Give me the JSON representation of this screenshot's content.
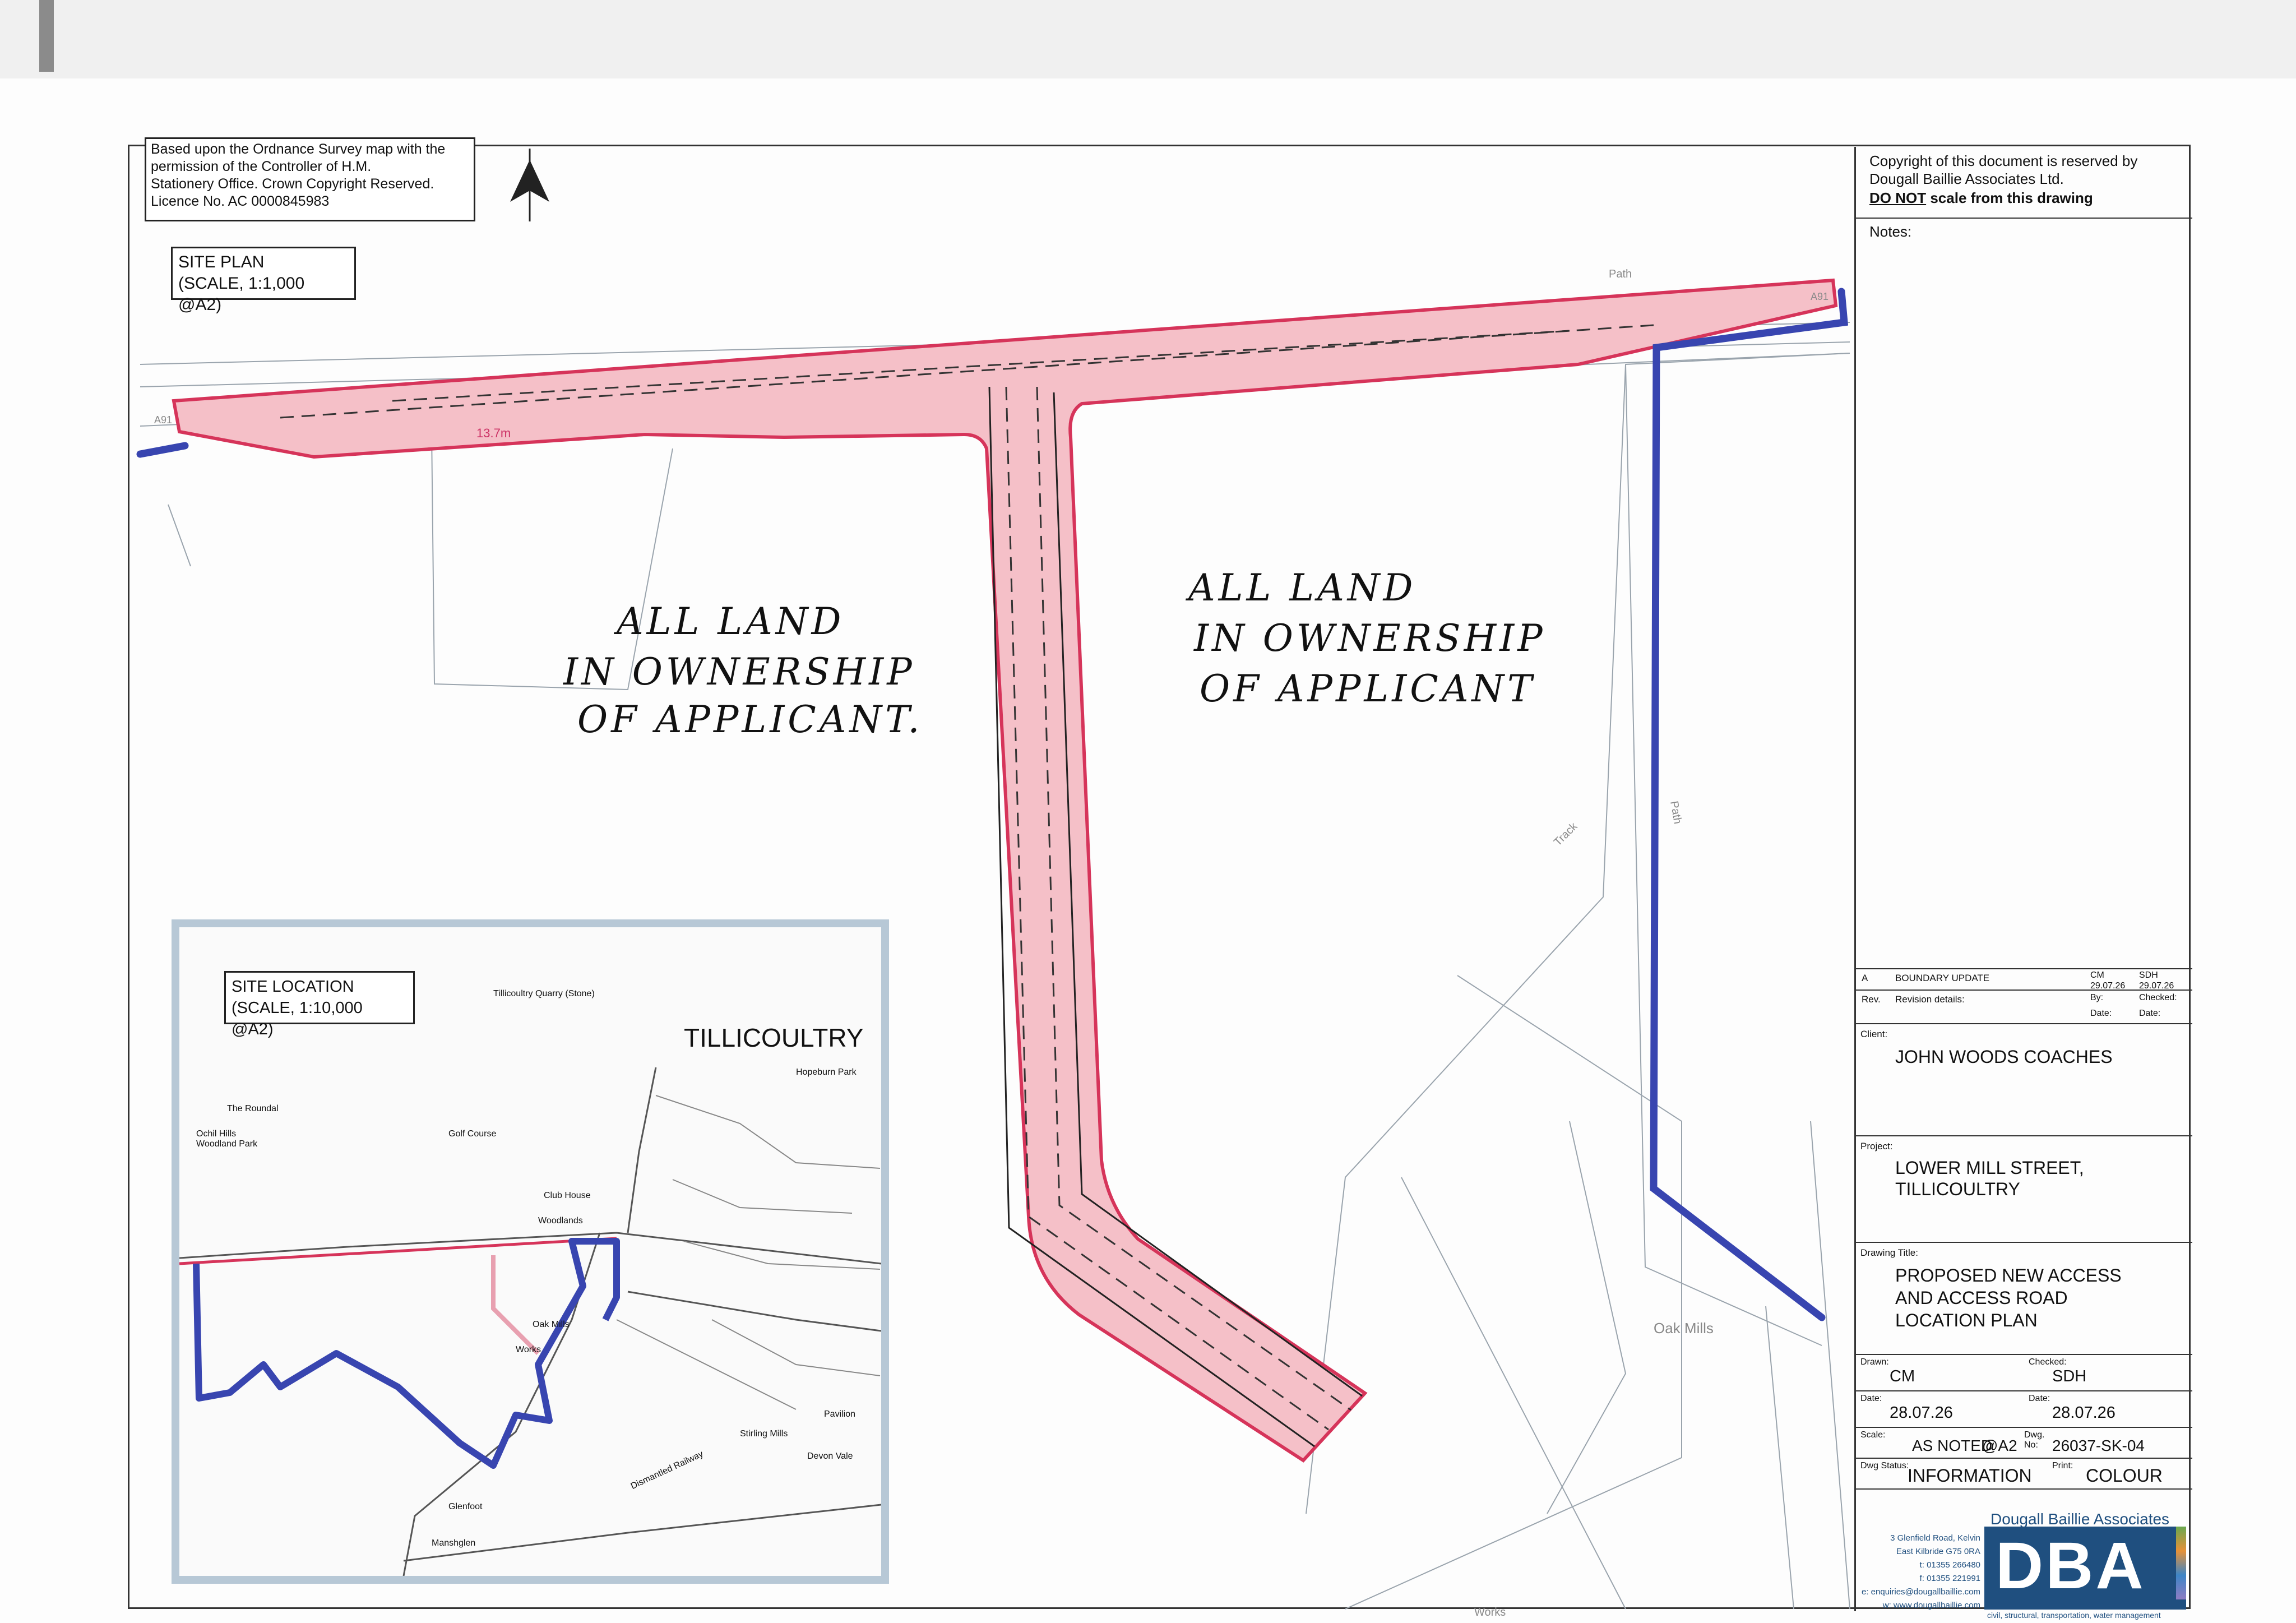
{
  "copyright_box": {
    "line1": "Based upon the Ordnance Survey map with the",
    "line2": "permission of the Controller of H.M.",
    "line3": "Stationery  Office. Crown Copyright Reserved.",
    "line4": "Licence No.  AC 0000845983"
  },
  "site_plan": {
    "title": "SITE PLAN",
    "scale": "(SCALE, 1:1,000 @A2)"
  },
  "map_labels": {
    "path_top": "Path",
    "path_right": "Path",
    "track": "Track",
    "height": "13.7m",
    "road_left": "A91",
    "road_right": "A91",
    "oak_mills": "Oak Mills",
    "works": "Works"
  },
  "handwritten": {
    "left": [
      "ALL LAND",
      "IN OWNERSHIP",
      "OF APPLICANT."
    ],
    "right": [
      "ALL LAND",
      "IN OWNERSHIP",
      "OF APPLICANT"
    ]
  },
  "inset": {
    "title": "SITE LOCATION",
    "scale": "(SCALE, 1:10,000 @A2)",
    "town": "TILLICOULTRY",
    "places": [
      "Tillicoultry Quarry (Stone)",
      "The Roundal",
      "Golf Course",
      "Ochil Hills Woodland Park",
      "Club House",
      "Woodlands",
      "Oak Mills",
      "Works",
      "Glenfoot",
      "Manshglen",
      "Stirling Mills",
      "Devon Vale",
      "Pavilion",
      "Hopeburn Park",
      "Dismantled Railway"
    ]
  },
  "title_block": {
    "copyright_line1": "Copyright of this document is reserved by",
    "copyright_line2": "Dougall Baillie Associates Ltd.",
    "do_not": "DO NOT",
    "scale_warning": "scale from this drawing",
    "notes_label": "Notes:",
    "rev_a": {
      "rev": "A",
      "details": "BOUNDARY UPDATE",
      "by": "CM",
      "checked": "SDH",
      "date_by": "29.07.26",
      "date_checked": "29.07.26"
    },
    "rev_headers": {
      "rev": "Rev.",
      "details": "Revision details:",
      "by": "By:",
      "checked": "Checked:",
      "date1": "Date:",
      "date2": "Date:"
    },
    "client_label": "Client:",
    "client": "JOHN WOODS COACHES",
    "project_label": "Project:",
    "project_line1": "LOWER MILL STREET,",
    "project_line2": "TILLICOULTRY",
    "drawing_title_label": "Drawing Title:",
    "drawing_title_line1": "PROPOSED NEW ACCESS",
    "drawing_title_line2": "AND ACCESS ROAD",
    "drawing_title_line3": "LOCATION PLAN",
    "drawn_label": "Drawn:",
    "drawn": "CM",
    "checked_label": "Checked:",
    "checked": "SDH",
    "date_label": "Date:",
    "date_drawn": "28.07.26",
    "date_checked": "28.07.26",
    "scale_label": "Scale:",
    "scale": "AS NOTED",
    "sheet": "@A2",
    "dwg_no_label": "Dwg. No:",
    "dwg_no": "26037-SK-04",
    "dwg_status_label": "Dwg Status:",
    "dwg_status": "INFORMATION",
    "print_label": "Print:",
    "print": "COLOUR",
    "company": "Dougall Baillie Associates",
    "address1": "3 Glenfield Road, Kelvin",
    "address2": "East Kilbride G75 0RA",
    "tel": "t: 01355 266480",
    "fax": "f: 01355 221991",
    "email": "e: enquiries@dougallbaillie.com",
    "web": "w: www.dougallbaillie.com",
    "logo": "DBA",
    "tagline": "civil, structural, transportation, water management"
  },
  "colors": {
    "red_line": "#d6345a",
    "red_fill": "#f5c0c8",
    "blue_line": "#3845b0"
  }
}
